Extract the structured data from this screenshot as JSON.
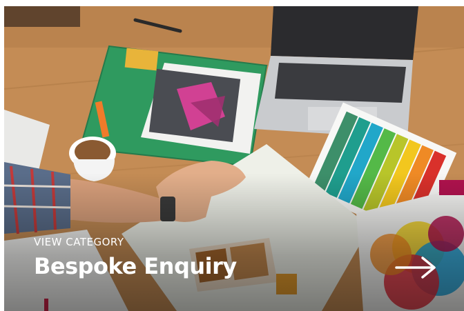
{
  "card": {
    "eyebrow": "VIEW CATEGORY",
    "title": "Bespoke Enquiry",
    "arrow_icon": "arrow-right-icon"
  },
  "colors": {
    "text": "#ffffff",
    "accent": "#b0124e"
  }
}
